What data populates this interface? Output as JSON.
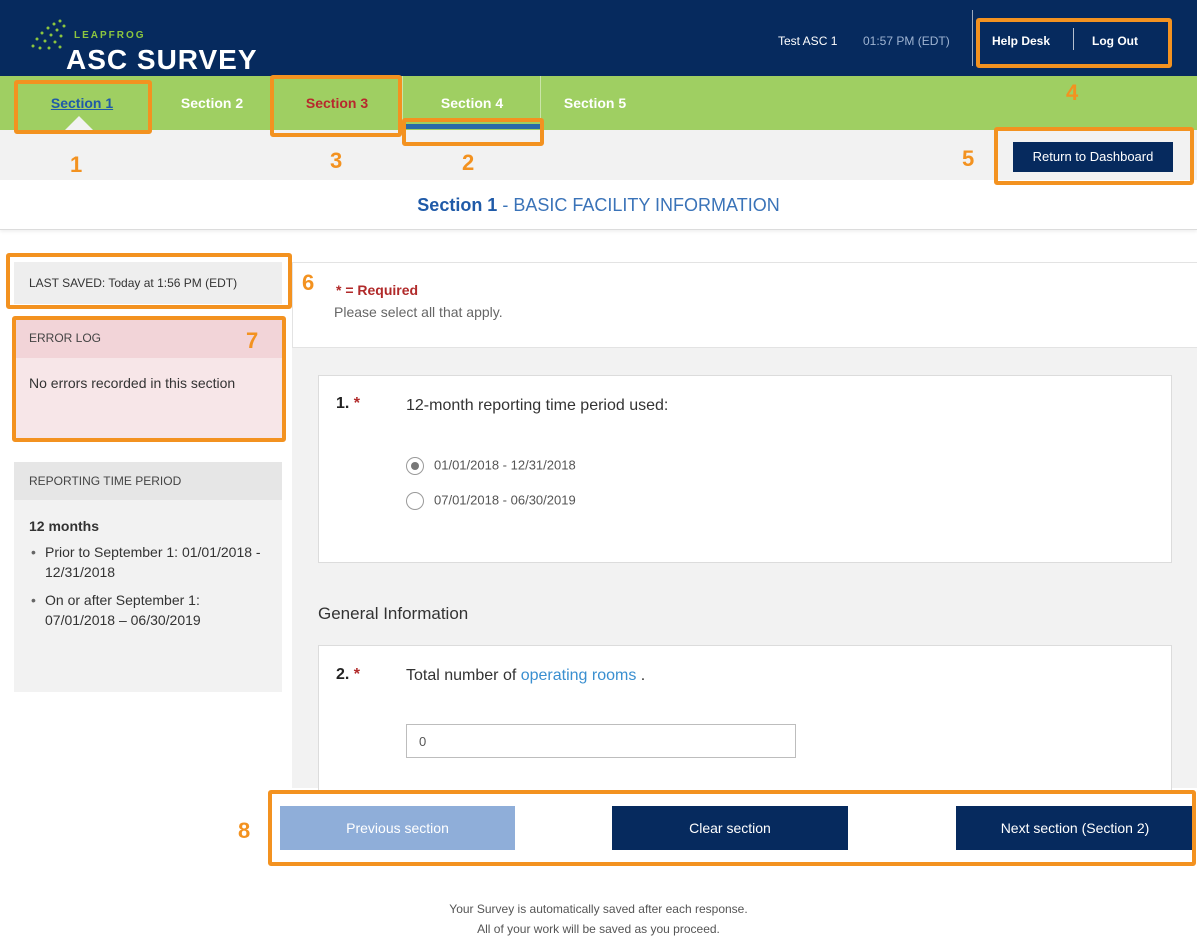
{
  "header": {
    "brand_small": "LEAPFROG",
    "brand_big": "ASC SURVEY",
    "user": "Test ASC 1",
    "time": "01:57 PM (EDT)",
    "help_desk": "Help Desk",
    "log_out": "Log Out"
  },
  "tabs": [
    {
      "label": "Section 1"
    },
    {
      "label": "Section 2"
    },
    {
      "label": "Section 3"
    },
    {
      "label": "Section 4"
    },
    {
      "label": "Section 5"
    }
  ],
  "subbar": {
    "return_label": "Return to Dashboard"
  },
  "section_title": {
    "number": "Section 1",
    "name": " - BASIC FACILITY INFORMATION"
  },
  "sidebar": {
    "last_saved": "LAST SAVED: Today at 1:56 PM (EDT)",
    "error_log_title": "ERROR LOG",
    "error_log_text": "No errors recorded in this section",
    "period_title": "REPORTING TIME PERIOD",
    "period_big": "12 months",
    "period_items": [
      "Prior to September 1: 01/01/2018 - 12/31/2018",
      "On or after September 1: 07/01/2018 – 06/30/2019"
    ]
  },
  "main": {
    "required_legend": "* = Required",
    "instructions": "Please select all that apply.",
    "q1": {
      "number": "1.",
      "star": "*",
      "text": "12-month reporting time period used:",
      "options": [
        {
          "label": "01/01/2018 - 12/31/2018",
          "selected": true
        },
        {
          "label": "07/01/2018 - 06/30/2019",
          "selected": false
        }
      ]
    },
    "general_heading": "General Information",
    "q2": {
      "number": "2.",
      "star": "*",
      "text_before": "Total number of ",
      "link_text": "operating rooms",
      "text_after": " .",
      "value": "0"
    }
  },
  "buttons": {
    "previous": "Previous section",
    "clear": "Clear section",
    "next": "Next section (Section 2)"
  },
  "footer": {
    "line1": "Your Survey is automatically saved after each response.",
    "line2": "All of your work will be saved as you proceed."
  },
  "annotations": [
    "1",
    "2",
    "3",
    "4",
    "5",
    "6",
    "7",
    "8"
  ],
  "colors": {
    "header_bg": "#062a5e",
    "tab_bg": "#9fcf62",
    "annotation": "#f39220",
    "required_red": "#b12a2a",
    "link_blue": "#3a8fd0"
  }
}
